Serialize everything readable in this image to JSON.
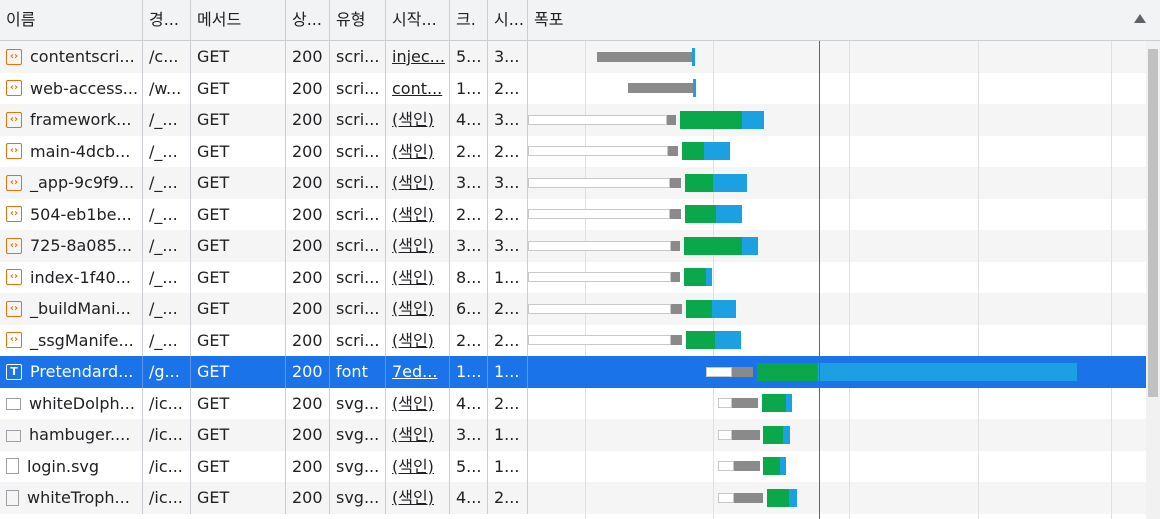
{
  "columns": [
    {
      "label": "이름"
    },
    {
      "label": "경..."
    },
    {
      "label": "메서드"
    },
    {
      "label": "상..."
    },
    {
      "label": "유형"
    },
    {
      "label": "시작..."
    },
    {
      "label": "크."
    },
    {
      "label": "시..."
    },
    {
      "label": "폭포"
    }
  ],
  "rows": [
    {
      "name": "contentscri...",
      "path": "/c...",
      "method": "GET",
      "status": "200",
      "type": "scri...",
      "initiator": "injec...",
      "size": "5...",
      "time": "3...",
      "icon": "script-icon",
      "initiator_link": true,
      "waterfall": {
        "wait_start": 0.112,
        "wait_end": 0.265,
        "queue": 0,
        "green": 0,
        "blue": 0.005
      }
    },
    {
      "name": "web-access...",
      "path": "/w...",
      "method": "GET",
      "status": "200",
      "type": "scri...",
      "initiator": "cont...",
      "size": "1...",
      "time": "2...",
      "icon": "script-icon",
      "initiator_link": true,
      "waterfall": {
        "wait_start": 0.162,
        "wait_end": 0.267,
        "queue": 0,
        "green": 0,
        "blue": 0.005
      }
    },
    {
      "name": "framework...",
      "path": "/_...",
      "method": "GET",
      "status": "200",
      "type": "scri...",
      "initiator": "(색인)",
      "size": "4...",
      "time": "3...",
      "icon": "script-icon",
      "initiator_link": true,
      "waterfall": {
        "queue_start": 0,
        "queue_end": 0.225,
        "wait_end": 0.24,
        "green": 0.1,
        "blue": 0.036
      }
    },
    {
      "name": "main-4dcb...",
      "path": "/_...",
      "method": "GET",
      "status": "200",
      "type": "scri...",
      "initiator": "(색인)",
      "size": "2...",
      "time": "2...",
      "icon": "script-icon",
      "initiator_link": true,
      "waterfall": {
        "queue_start": 0,
        "queue_end": 0.227,
        "wait_end": 0.243,
        "green": 0.036,
        "blue": 0.042
      }
    },
    {
      "name": "_app-9c9f9...",
      "path": "/_...",
      "method": "GET",
      "status": "200",
      "type": "scri...",
      "initiator": "(색인)",
      "size": "3...",
      "time": "3...",
      "icon": "script-icon",
      "initiator_link": true,
      "waterfall": {
        "queue_start": 0,
        "queue_end": 0.23,
        "wait_end": 0.248,
        "green": 0.045,
        "blue": 0.055
      }
    },
    {
      "name": "504-eb1be...",
      "path": "/_...",
      "method": "GET",
      "status": "200",
      "type": "scri...",
      "initiator": "(색인)",
      "size": "2...",
      "time": "2...",
      "icon": "script-icon",
      "initiator_link": true,
      "waterfall": {
        "queue_start": 0,
        "queue_end": 0.23,
        "wait_end": 0.248,
        "green": 0.05,
        "blue": 0.042
      }
    },
    {
      "name": "725-8a085...",
      "path": "/_...",
      "method": "GET",
      "status": "200",
      "type": "scri...",
      "initiator": "(색인)",
      "size": "3...",
      "time": "3...",
      "icon": "script-icon",
      "initiator_link": true,
      "waterfall": {
        "queue_start": 0,
        "queue_end": 0.231,
        "wait_end": 0.246,
        "green": 0.094,
        "blue": 0.026
      }
    },
    {
      "name": "index-1f40...",
      "path": "/_...",
      "method": "GET",
      "status": "200",
      "type": "scri...",
      "initiator": "(색인)",
      "size": "8...",
      "time": "1...",
      "icon": "script-icon",
      "initiator_link": true,
      "waterfall": {
        "queue_start": 0,
        "queue_end": 0.231,
        "wait_end": 0.246,
        "green": 0.036,
        "blue": 0.01
      }
    },
    {
      "name": "_buildMani...",
      "path": "/_...",
      "method": "GET",
      "status": "200",
      "type": "scri...",
      "initiator": "(색인)",
      "size": "6...",
      "time": "2...",
      "icon": "script-icon",
      "initiator_link": true,
      "waterfall": {
        "queue_start": 0,
        "queue_end": 0.231,
        "wait_end": 0.249,
        "green": 0.042,
        "blue": 0.04
      }
    },
    {
      "name": "_ssgManife...",
      "path": "/_...",
      "method": "GET",
      "status": "200",
      "type": "scri...",
      "initiator": "(색인)",
      "size": "2...",
      "time": "2...",
      "icon": "script-icon",
      "initiator_link": true,
      "waterfall": {
        "queue_start": 0,
        "queue_end": 0.231,
        "wait_end": 0.25,
        "green": 0.047,
        "blue": 0.042
      }
    },
    {
      "name": "Pretendard...",
      "path": "/g...",
      "method": "GET",
      "status": "200",
      "type": "font",
      "initiator": "7ed...",
      "size": "1...",
      "time": "1...",
      "icon": "font-icon",
      "initiator_link": true,
      "selected": true,
      "waterfall": {
        "queue_start": 0.288,
        "queue_end": 0.33,
        "wait_end": 0.364,
        "green": 0.1,
        "blue": 0.418
      }
    },
    {
      "name": "whiteDolph...",
      "path": "/ic...",
      "method": "GET",
      "status": "200",
      "type": "svg...",
      "initiator": "(색인)",
      "size": "4...",
      "time": "2...",
      "icon": "svg-icon",
      "initiator_link": true,
      "waterfall": {
        "queue_start": 0.307,
        "queue_end": 0.33,
        "wait_end": 0.372,
        "green": 0.04,
        "blue": 0.01
      }
    },
    {
      "name": "hambuger....",
      "path": "/ic...",
      "method": "GET",
      "status": "200",
      "type": "svg...",
      "initiator": "(색인)",
      "size": "3...",
      "time": "1...",
      "icon": "svg-icon",
      "initiator_link": true,
      "waterfall": {
        "queue_start": 0.307,
        "queue_end": 0.33,
        "wait_end": 0.375,
        "green": 0.031,
        "blue": 0.012
      }
    },
    {
      "name": "login.svg",
      "path": "/ic...",
      "method": "GET",
      "status": "200",
      "type": "svg...",
      "initiator": "(색인)",
      "size": "5...",
      "time": "1...",
      "icon": "doc-icon",
      "initiator_link": true,
      "waterfall": {
        "queue_start": 0.307,
        "queue_end": 0.333,
        "wait_end": 0.375,
        "green": 0.026,
        "blue": 0.01
      }
    },
    {
      "name": "whiteTroph...",
      "path": "/ic...",
      "method": "GET",
      "status": "200",
      "type": "svg...",
      "initiator": "(색인)",
      "size": "4...",
      "time": "2...",
      "icon": "doc-icon",
      "initiator_link": true,
      "waterfall": {
        "queue_start": 0.307,
        "queue_end": 0.333,
        "wait_end": 0.381,
        "green": 0.036,
        "blue": 0.012
      }
    }
  ],
  "waterfall_markers": {
    "blue_line": 0.471,
    "red_line": null
  },
  "colors": {
    "accent": "#1a73e8",
    "green": "#0aa74b",
    "blue": "#1ba1e2",
    "wait": "#8a8a8a",
    "queue": "#ffffff"
  }
}
